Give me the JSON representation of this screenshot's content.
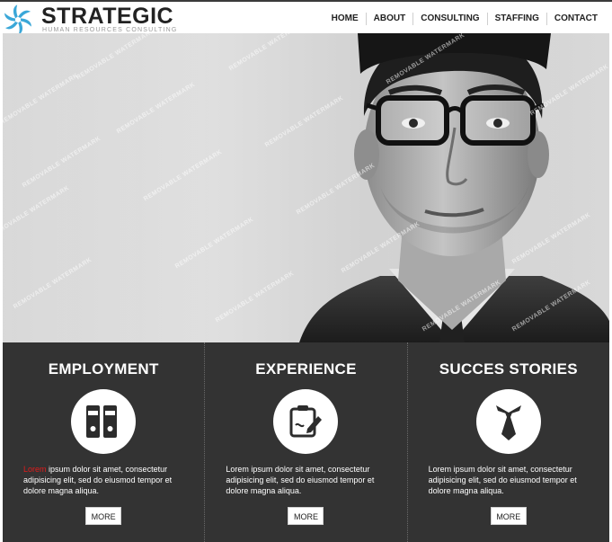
{
  "brand": {
    "name": "STRATEGIC",
    "tagline": "HUMAN RESOURCES CONSULTING",
    "logo_icon": "swirl-logo-icon",
    "accent": "#3aa7d8"
  },
  "nav": {
    "items": [
      "HOME",
      "ABOUT",
      "CONSULTING",
      "STAFFING",
      "CONTACT"
    ]
  },
  "hero": {
    "image": "portrait-of-man-with-glasses",
    "watermark": "REMOVABLE WATERMARK"
  },
  "features": {
    "background": "#333333",
    "highlight_color": "#e11b1b",
    "columns": [
      {
        "title": "EMPLOYMENT",
        "icon": "binders-icon",
        "text_highlight": "Lorem",
        "text": " ipsum dolor sit amet, consectetur adipisicing elit, sed do eiusmod tempor et dolore magna aliqua.",
        "button": "MORE"
      },
      {
        "title": "EXPERIENCE",
        "icon": "clipboard-pencil-icon",
        "text_highlight": "",
        "text": "Lorem ipsum dolor sit amet, consectetur adipisicing elit, sed do eiusmod tempor et dolore magna aliqua.",
        "button": "MORE"
      },
      {
        "title": "SUCCES STORIES",
        "icon": "necktie-icon",
        "text_highlight": "",
        "text": "Lorem ipsum dolor sit amet, consectetur adipisicing elit, sed do eiusmod tempor et dolore magna aliqua.",
        "button": "MORE"
      }
    ]
  }
}
